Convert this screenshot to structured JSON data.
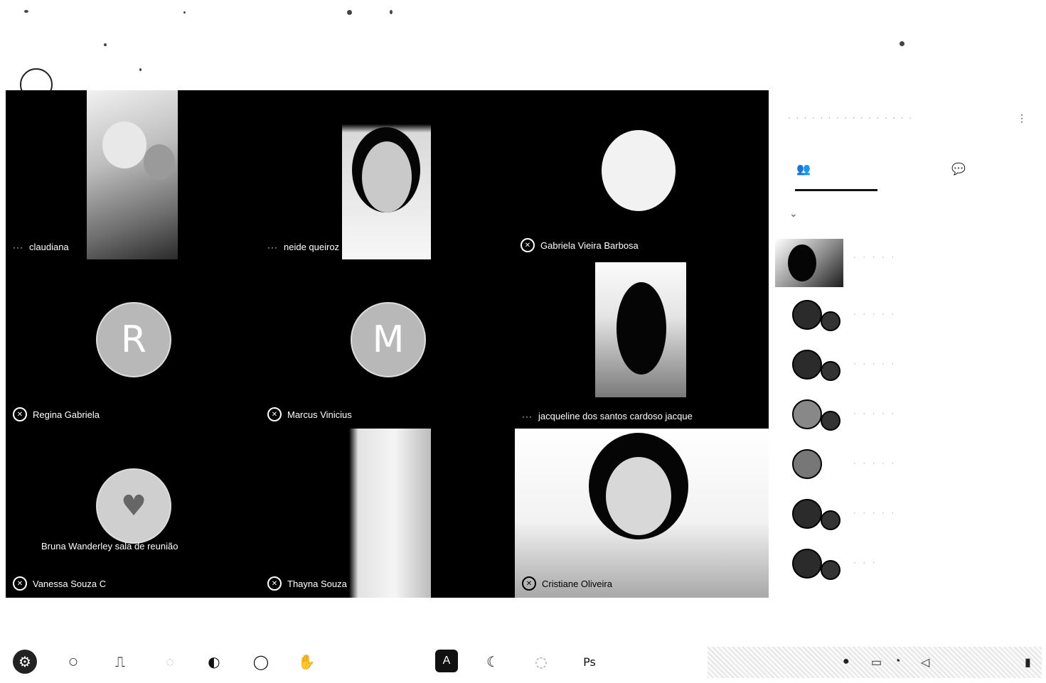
{
  "participants": [
    {
      "name": "claudiana",
      "tile": "claudiana"
    },
    {
      "name": "neide queiroz",
      "tile": "neide"
    },
    {
      "name": "Gabriela Vieira Barbosa",
      "tile": "gabriela"
    },
    {
      "name": "Regina Gabriela",
      "tile": "regina"
    },
    {
      "name": "Marcus Vinicius",
      "tile": "marcus"
    },
    {
      "name": "jacqueline dos santos cardoso jacque",
      "tile": "jacqueline"
    },
    {
      "name": "Vanessa Souza C",
      "tile": "vanessa"
    },
    {
      "name": "Thayna Souza",
      "tile": "thayna"
    },
    {
      "name": "Cristiane Oliveira",
      "tile": "cristiane"
    }
  ],
  "tiles": {
    "claudiana": {
      "name": "claudiana",
      "more": "···"
    },
    "neide": {
      "name": "neide queiroz",
      "more": "···"
    },
    "gabriela": {
      "name": "Gabriela Vieira Barbosa"
    },
    "regina": {
      "name": "Regina Gabriela",
      "avatar_letter": "R"
    },
    "marcus": {
      "name": "Marcus Vinicius",
      "avatar_letter": "M"
    },
    "jacqueline": {
      "name": "jacqueline dos santos cardoso jacque",
      "more": "···"
    },
    "vanessa": {
      "name": "Vanessa Souza C",
      "caption": "Bruna Wanderley sala de reunião"
    },
    "thayna": {
      "name": "Thayna Souza"
    },
    "cristiane": {
      "name": "Cristiane Oliveira"
    }
  },
  "icons": {
    "mic": "microphone-off-icon",
    "participants_tab": "people-icon",
    "chat_tab": "chat-icon"
  },
  "colors": {
    "grid_bg": "#000000",
    "avatar_bg": "#b8b8b8"
  }
}
